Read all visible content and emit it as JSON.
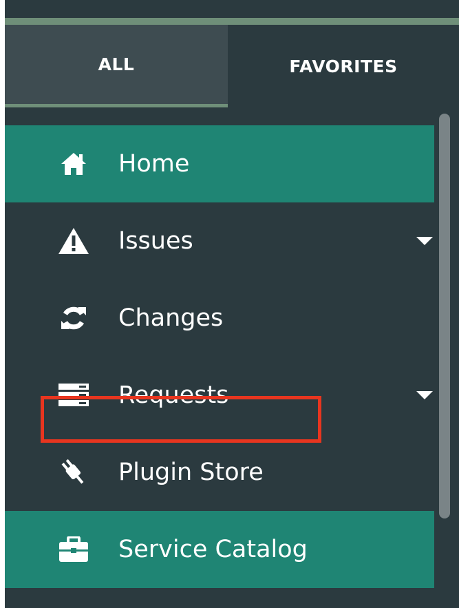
{
  "tabs": {
    "all_label": "ALL",
    "favorites_label": "FAVORITES"
  },
  "menu": {
    "items": [
      {
        "label": "Home",
        "icon": "home-icon",
        "active": true
      },
      {
        "label": "Issues",
        "icon": "warning-icon",
        "has_submenu": true
      },
      {
        "label": "Changes",
        "icon": "refresh-icon"
      },
      {
        "label": "Requests",
        "icon": "server-icon",
        "has_submenu": true
      },
      {
        "label": "Plugin Store",
        "icon": "plug-icon"
      },
      {
        "label": "Service Catalog",
        "icon": "briefcase-icon",
        "active": true,
        "highlighted": true
      }
    ]
  },
  "colors": {
    "background": "#2b3a3f",
    "active_item": "#1f8574",
    "tab_selected": "#3e4c51",
    "accent_rule": "#6f8f79",
    "highlight_border": "#e8351f"
  }
}
